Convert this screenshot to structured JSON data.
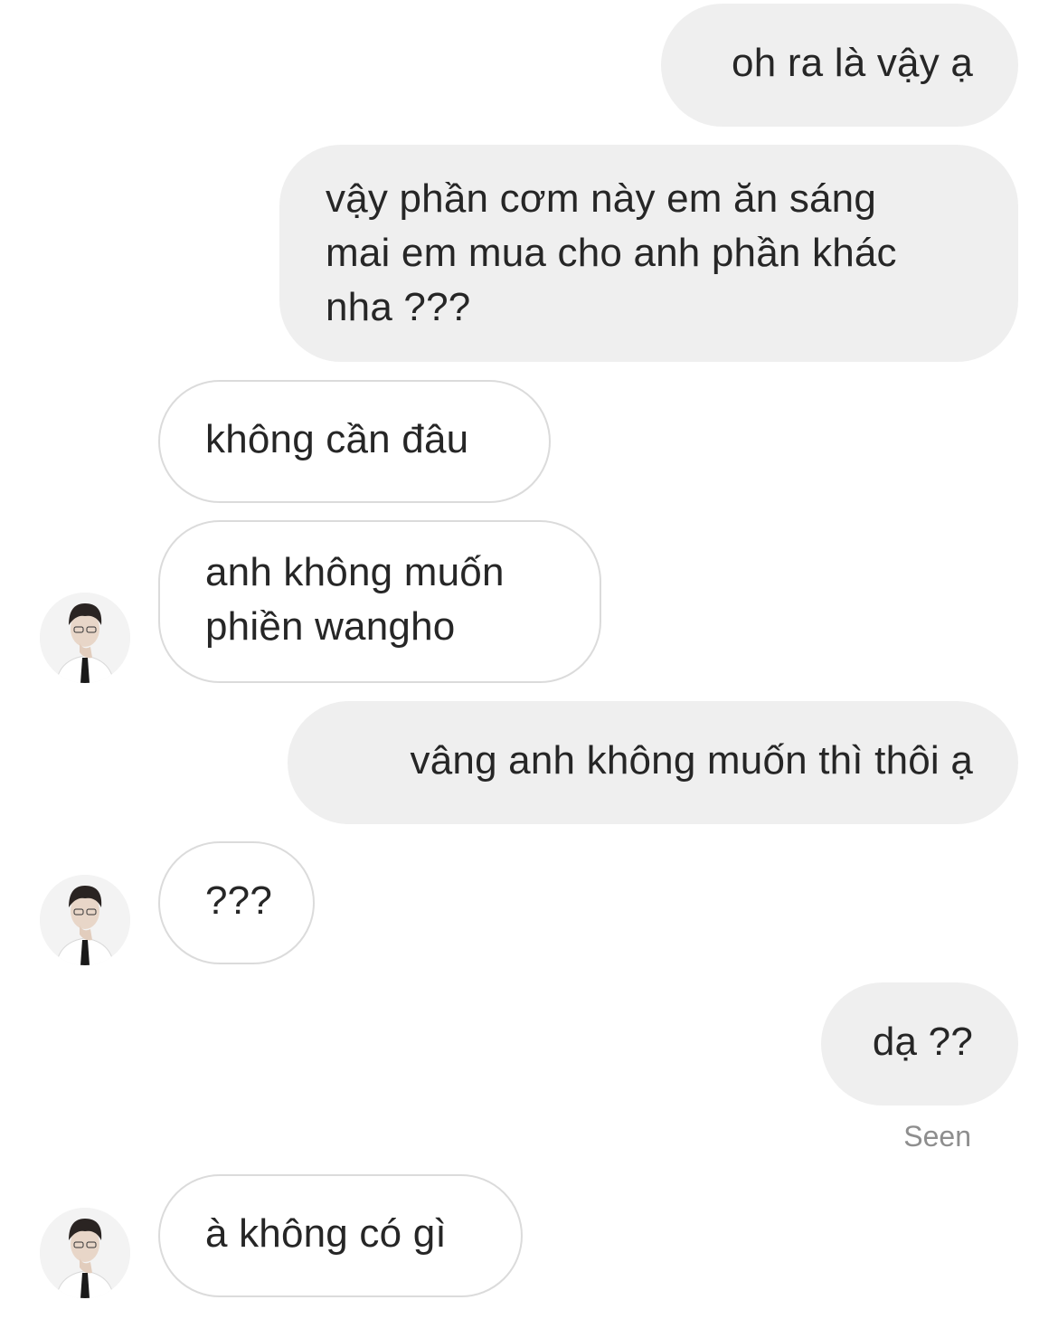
{
  "conversation": {
    "messages": [
      {
        "sender": "me",
        "text": "oh ra là vậy ạ"
      },
      {
        "sender": "me",
        "text": "vậy phần cơm này em ăn sáng\nmai em mua cho anh phần khác\nnha ???"
      },
      {
        "sender": "other",
        "text": "không cần đâu"
      },
      {
        "sender": "other",
        "text": "anh không muốn\nphiền wangho"
      },
      {
        "sender": "me",
        "text": "vâng anh không muốn thì thôi ạ"
      },
      {
        "sender": "other",
        "text": "???"
      },
      {
        "sender": "me",
        "text": "dạ ??"
      },
      {
        "sender": "other",
        "text": "à không có gì"
      }
    ],
    "seen_label": "Seen"
  },
  "colors": {
    "outgoing_bubble": "#efefef",
    "incoming_border": "#dbdbdb",
    "text": "#262626",
    "seen_text": "#8e8e8e"
  },
  "icons": {
    "avatar": "profile-photo-avatar"
  }
}
